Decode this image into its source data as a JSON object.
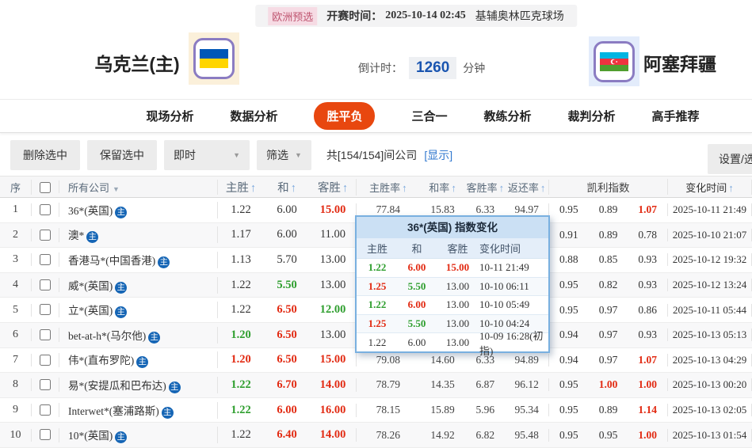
{
  "header": {
    "league_badge": "欧洲预选",
    "kickoff_label": "开赛时间：",
    "kickoff_time": "2025-10-14 02:45",
    "venue": "基辅奥林匹克球场",
    "home_team": "乌克兰(主)",
    "away_team": "阿塞拜疆",
    "countdown_label": "倒计时：",
    "countdown_value": "1260",
    "countdown_unit": "分钟"
  },
  "nav": {
    "tabs": [
      {
        "label": "现场分析",
        "active": false
      },
      {
        "label": "数据分析",
        "active": false
      },
      {
        "label": "胜平负",
        "active": true
      },
      {
        "label": "三合一",
        "active": false
      },
      {
        "label": "教练分析",
        "active": false
      },
      {
        "label": "裁判分析",
        "active": false
      },
      {
        "label": "高手推荐",
        "active": false
      }
    ]
  },
  "toolbar": {
    "delete_selected": "删除选中",
    "keep_selected": "保留选中",
    "instant": "即时",
    "filter": "筛选",
    "company_count": "共[154/154]间公司",
    "show_link": "[显示]",
    "settings": "设置/选择"
  },
  "table": {
    "headers": {
      "seq": "序",
      "company": "所有公司",
      "home_win": "主胜",
      "draw": "和",
      "away_win": "客胜",
      "home_rate": "主胜率",
      "draw_rate": "和率",
      "away_rate": "客胜率",
      "payout_rate": "返还率",
      "kelly": "凯利指数",
      "change_time": "变化时间"
    },
    "home_badge": "主",
    "rows": [
      {
        "seq": "1",
        "company": "36*(英国)",
        "odds": [
          {
            "v": "1.22",
            "c": "k"
          },
          {
            "v": "6.00",
            "c": "k"
          },
          {
            "v": "15.00",
            "c": "r"
          }
        ],
        "rates": [
          "77.84",
          "15.83",
          "6.33",
          "94.97"
        ],
        "kelly": [
          {
            "v": "0.95",
            "c": "k"
          },
          {
            "v": "0.89",
            "c": "k"
          },
          {
            "v": "1.07",
            "c": "r"
          }
        ],
        "time": "2025-10-11 21:49"
      },
      {
        "seq": "2",
        "company": "澳*",
        "odds": [
          {
            "v": "1.17",
            "c": "k"
          },
          {
            "v": "6.00",
            "c": "k"
          },
          {
            "v": "11.00",
            "c": "k"
          }
        ],
        "rates": [
          "",
          "",
          "",
          ""
        ],
        "kelly": [
          {
            "v": "0.91",
            "c": "k"
          },
          {
            "v": "0.89",
            "c": "k"
          },
          {
            "v": "0.78",
            "c": "k"
          }
        ],
        "time": "2025-10-10 21:07"
      },
      {
        "seq": "3",
        "company": "香港马*(中国香港)",
        "odds": [
          {
            "v": "1.13",
            "c": "k"
          },
          {
            "v": "5.70",
            "c": "k"
          },
          {
            "v": "13.00",
            "c": "k"
          }
        ],
        "rates": [
          "",
          "",
          "",
          ""
        ],
        "kelly": [
          {
            "v": "0.88",
            "c": "k"
          },
          {
            "v": "0.85",
            "c": "k"
          },
          {
            "v": "0.93",
            "c": "k"
          }
        ],
        "time": "2025-10-12 19:32"
      },
      {
        "seq": "4",
        "company": "威*(英国)",
        "odds": [
          {
            "v": "1.22",
            "c": "k"
          },
          {
            "v": "5.50",
            "c": "g"
          },
          {
            "v": "13.00",
            "c": "k"
          }
        ],
        "rates": [
          "",
          "",
          "",
          ""
        ],
        "kelly": [
          {
            "v": "0.95",
            "c": "k"
          },
          {
            "v": "0.82",
            "c": "k"
          },
          {
            "v": "0.93",
            "c": "k"
          }
        ],
        "time": "2025-10-12 13:24"
      },
      {
        "seq": "5",
        "company": "立*(英国)",
        "odds": [
          {
            "v": "1.22",
            "c": "k"
          },
          {
            "v": "6.50",
            "c": "r"
          },
          {
            "v": "12.00",
            "c": "g"
          }
        ],
        "rates": [
          "",
          "",
          "",
          ""
        ],
        "kelly": [
          {
            "v": "0.95",
            "c": "k"
          },
          {
            "v": "0.97",
            "c": "k"
          },
          {
            "v": "0.86",
            "c": "k"
          }
        ],
        "time": "2025-10-11 05:44"
      },
      {
        "seq": "6",
        "company": "bet-at-h*(马尔他)",
        "odds": [
          {
            "v": "1.20",
            "c": "g"
          },
          {
            "v": "6.50",
            "c": "r"
          },
          {
            "v": "13.00",
            "c": "k"
          }
        ],
        "rates": [
          "",
          "",
          "",
          ""
        ],
        "kelly": [
          {
            "v": "0.94",
            "c": "k"
          },
          {
            "v": "0.97",
            "c": "k"
          },
          {
            "v": "0.93",
            "c": "k"
          }
        ],
        "time": "2025-10-13 05:13"
      },
      {
        "seq": "7",
        "company": "伟*(直布罗陀)",
        "odds": [
          {
            "v": "1.20",
            "c": "r"
          },
          {
            "v": "6.50",
            "c": "r"
          },
          {
            "v": "15.00",
            "c": "r"
          }
        ],
        "rates": [
          "79.08",
          "14.60",
          "6.33",
          "94.89"
        ],
        "kelly": [
          {
            "v": "0.94",
            "c": "k"
          },
          {
            "v": "0.97",
            "c": "k"
          },
          {
            "v": "1.07",
            "c": "r"
          }
        ],
        "time": "2025-10-13 04:29"
      },
      {
        "seq": "8",
        "company": "易*(安提瓜和巴布达)",
        "odds": [
          {
            "v": "1.22",
            "c": "g"
          },
          {
            "v": "6.70",
            "c": "r"
          },
          {
            "v": "14.00",
            "c": "r"
          }
        ],
        "rates": [
          "78.79",
          "14.35",
          "6.87",
          "96.12"
        ],
        "kelly": [
          {
            "v": "0.95",
            "c": "k"
          },
          {
            "v": "1.00",
            "c": "r"
          },
          {
            "v": "1.00",
            "c": "r"
          }
        ],
        "time": "2025-10-13 00:20"
      },
      {
        "seq": "9",
        "company": "Interwet*(塞浦路斯)",
        "odds": [
          {
            "v": "1.22",
            "c": "g"
          },
          {
            "v": "6.00",
            "c": "r"
          },
          {
            "v": "16.00",
            "c": "r"
          }
        ],
        "rates": [
          "78.15",
          "15.89",
          "5.96",
          "95.34"
        ],
        "kelly": [
          {
            "v": "0.95",
            "c": "k"
          },
          {
            "v": "0.89",
            "c": "k"
          },
          {
            "v": "1.14",
            "c": "r"
          }
        ],
        "time": "2025-10-13 02:05"
      },
      {
        "seq": "10",
        "company": "10*(英国)",
        "odds": [
          {
            "v": "1.22",
            "c": "k"
          },
          {
            "v": "6.40",
            "c": "r"
          },
          {
            "v": "14.00",
            "c": "r"
          }
        ],
        "rates": [
          "78.26",
          "14.92",
          "6.82",
          "95.48"
        ],
        "kelly": [
          {
            "v": "0.95",
            "c": "k"
          },
          {
            "v": "0.95",
            "c": "k"
          },
          {
            "v": "1.00",
            "c": "r"
          }
        ],
        "time": "2025-10-13 01:54"
      }
    ]
  },
  "popup": {
    "title": "36*(英国) 指数变化",
    "headers": [
      "主胜",
      "和",
      "客胜",
      "变化时间"
    ],
    "rows": [
      [
        {
          "v": "1.22",
          "c": "g"
        },
        {
          "v": "6.00",
          "c": "r"
        },
        {
          "v": "15.00",
          "c": "r"
        },
        {
          "v": "10-11 21:49",
          "c": "k"
        }
      ],
      [
        {
          "v": "1.25",
          "c": "r"
        },
        {
          "v": "5.50",
          "c": "g"
        },
        {
          "v": "13.00",
          "c": "k"
        },
        {
          "v": "10-10 06:11",
          "c": "k"
        }
      ],
      [
        {
          "v": "1.22",
          "c": "g"
        },
        {
          "v": "6.00",
          "c": "r"
        },
        {
          "v": "13.00",
          "c": "k"
        },
        {
          "v": "10-10 05:49",
          "c": "k"
        }
      ],
      [
        {
          "v": "1.25",
          "c": "r"
        },
        {
          "v": "5.50",
          "c": "g"
        },
        {
          "v": "13.00",
          "c": "k"
        },
        {
          "v": "10-10 04:24",
          "c": "k"
        }
      ],
      [
        {
          "v": "1.22",
          "c": "k"
        },
        {
          "v": "6.00",
          "c": "k"
        },
        {
          "v": "13.00",
          "c": "k"
        },
        {
          "v": "10-09 16:28(初指)",
          "c": "k"
        }
      ]
    ]
  },
  "colors": {
    "accent_tab": "#e8470f",
    "odds_red": "#e22a12",
    "odds_green": "#2e9e2e",
    "link_blue": "#3278cf",
    "sort_arrow_blue": "#7ca9dd",
    "home_badge_blue": "#1565b5",
    "countdown_blue": "#1a55b0",
    "popup_border_blue": "#79b0e0",
    "league_badge_pink": "#f6dbe4"
  },
  "icons": {
    "sort_asc": "↑",
    "chevron_down": "▼"
  }
}
